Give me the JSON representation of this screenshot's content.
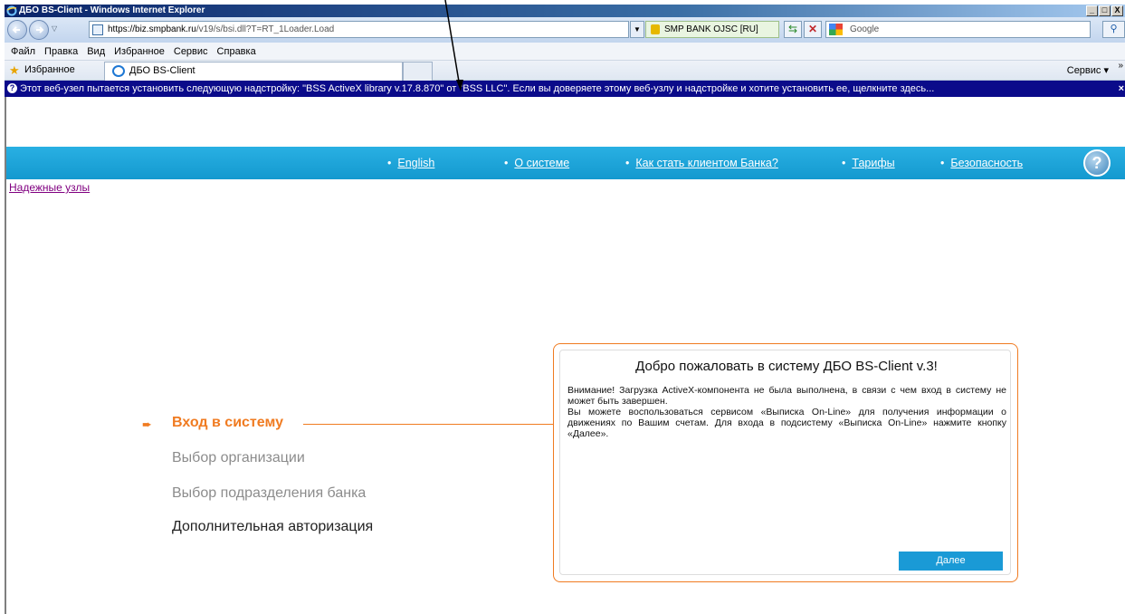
{
  "window": {
    "title": "ДБО BS-Client - Windows Internet Explorer",
    "controls": [
      "_",
      "□",
      "X"
    ]
  },
  "addressbar": {
    "url_domain": "https://biz.smpbank.ru",
    "url_path": "/v19/s/bsi.dll?T=RT_1Loader.Load",
    "security_label": "SMP BANK OJSC [RU]",
    "search_placeholder": "Google"
  },
  "menubar": {
    "items": [
      "Файл",
      "Правка",
      "Вид",
      "Избранное",
      "Сервис",
      "Справка"
    ]
  },
  "favbar": {
    "favorites_label": "Избранное",
    "tab_title": "ДБО BS-Client",
    "service_label": "Сервис ▾",
    "overflow": "»"
  },
  "infobar": {
    "message": "Этот веб-узел пытается установить следующую надстройку: \"BSS ActiveX library v.17.8.870\" от \"BSS LLC\". Если вы доверяете этому веб-узлу и надстройке и хотите установить ее, щелкните здесь...",
    "close": "×"
  },
  "site": {
    "nav": [
      "English",
      "О системе",
      "Как стать клиентом Банка?",
      "Тарифы",
      "Безопасность"
    ],
    "help": "?",
    "trusted_link": "Надежные узлы",
    "steps": {
      "active": "Вход в систему",
      "step2": "Выбор организации",
      "step3": "Выбор подразделения банка",
      "step4": "Дополнительная авторизация"
    }
  },
  "dialog": {
    "title": "Добро пожаловать в систему ДБО BS-Client v.3!",
    "para1": "Внимание! Загрузка ActiveX-компонента не была выполнена, в связи с чем вход в систему не может быть завершен.",
    "para2": "Вы можете воспользоваться сервисом «Выписка On-Line» для получения информации о движениях по Вашим счетам. Для входа в подсистему «Выписка On-Line» нажмите кнопку «Далее».",
    "next_button": "Далее"
  },
  "colors": {
    "accent_orange": "#f07b21",
    "header_blue": "#1499cf",
    "infobar_navy": "#0b0b8a"
  }
}
